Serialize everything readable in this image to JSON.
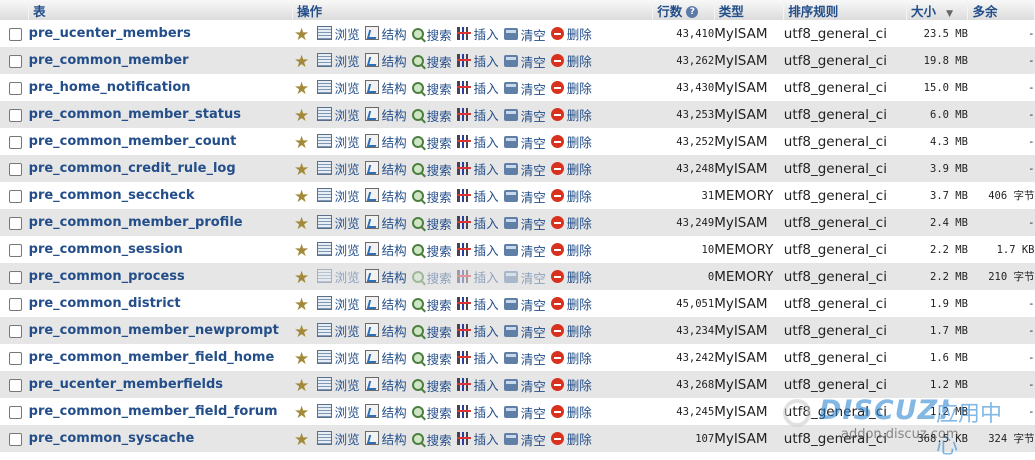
{
  "headers": {
    "table": "表",
    "ops": "操作",
    "rows": "行数",
    "type": "类型",
    "collation": "排序规则",
    "size": "大小",
    "overhead": "多余"
  },
  "help_icon": "?",
  "sort_icon": "▼",
  "action_labels": {
    "browse": "浏览",
    "structure": "结构",
    "search": "搜索",
    "insert": "插入",
    "empty": "清空",
    "drop": "删除"
  },
  "icons": {
    "favorite": "star-icon",
    "browse": "browse-icon",
    "structure": "structure-icon",
    "search": "search-icon",
    "insert": "insert-icon",
    "empty": "empty-icon",
    "drop": "drop-icon"
  },
  "colors": {
    "link": "#234e89",
    "row_alt": "#e6e6e6",
    "header_bg": "#dcdcdc",
    "drop_red": "#d8311e"
  },
  "tables": [
    {
      "name": "pre_ucenter_members",
      "rows": "43,410",
      "type": "MyISAM",
      "collation": "utf8_general_ci",
      "size": "23.5 MB",
      "overhead": "-",
      "empty_disabled": false
    },
    {
      "name": "pre_common_member",
      "rows": "43,262",
      "type": "MyISAM",
      "collation": "utf8_general_ci",
      "size": "19.8 MB",
      "overhead": "-",
      "empty_disabled": false
    },
    {
      "name": "pre_home_notification",
      "rows": "43,430",
      "type": "MyISAM",
      "collation": "utf8_general_ci",
      "size": "15.0 MB",
      "overhead": "-",
      "empty_disabled": false
    },
    {
      "name": "pre_common_member_status",
      "rows": "43,253",
      "type": "MyISAM",
      "collation": "utf8_general_ci",
      "size": "6.0 MB",
      "overhead": "-",
      "empty_disabled": false
    },
    {
      "name": "pre_common_member_count",
      "rows": "43,252",
      "type": "MyISAM",
      "collation": "utf8_general_ci",
      "size": "4.3 MB",
      "overhead": "-",
      "empty_disabled": false
    },
    {
      "name": "pre_common_credit_rule_log",
      "rows": "43,248",
      "type": "MyISAM",
      "collation": "utf8_general_ci",
      "size": "3.9 MB",
      "overhead": "-",
      "empty_disabled": false
    },
    {
      "name": "pre_common_seccheck",
      "rows": "31",
      "type": "MEMORY",
      "collation": "utf8_general_ci",
      "size": "3.7 MB",
      "overhead": "406 字节",
      "empty_disabled": false
    },
    {
      "name": "pre_common_member_profile",
      "rows": "43,249",
      "type": "MyISAM",
      "collation": "utf8_general_ci",
      "size": "2.4 MB",
      "overhead": "-",
      "empty_disabled": false
    },
    {
      "name": "pre_common_session",
      "rows": "10",
      "type": "MEMORY",
      "collation": "utf8_general_ci",
      "size": "2.2 MB",
      "overhead": "1.7 KB",
      "empty_disabled": false
    },
    {
      "name": "pre_common_process",
      "rows": "0",
      "type": "MEMORY",
      "collation": "utf8_general_ci",
      "size": "2.2 MB",
      "overhead": "210 字节",
      "empty_disabled": true
    },
    {
      "name": "pre_common_district",
      "rows": "45,051",
      "type": "MyISAM",
      "collation": "utf8_general_ci",
      "size": "1.9 MB",
      "overhead": "-",
      "empty_disabled": false
    },
    {
      "name": "pre_common_member_newprompt",
      "rows": "43,234",
      "type": "MyISAM",
      "collation": "utf8_general_ci",
      "size": "1.7 MB",
      "overhead": "-",
      "empty_disabled": false
    },
    {
      "name": "pre_common_member_field_home",
      "rows": "43,242",
      "type": "MyISAM",
      "collation": "utf8_general_ci",
      "size": "1.6 MB",
      "overhead": "-",
      "empty_disabled": false
    },
    {
      "name": "pre_ucenter_memberfields",
      "rows": "43,268",
      "type": "MyISAM",
      "collation": "utf8_general_ci",
      "size": "1.2 MB",
      "overhead": "-",
      "empty_disabled": false
    },
    {
      "name": "pre_common_member_field_forum",
      "rows": "43,245",
      "type": "MyISAM",
      "collation": "utf8_general_ci",
      "size": "1.2 MB",
      "overhead": "-",
      "empty_disabled": false
    },
    {
      "name": "pre_common_syscache",
      "rows": "107",
      "type": "MyISAM",
      "collation": "utf8_general_ci",
      "size": "368.5 KB",
      "overhead": "324 字节",
      "empty_disabled": false
    }
  ],
  "watermark": {
    "logo": "DISCUZ!",
    "cn": "应用中心",
    "url": "addon.discuz.com"
  }
}
